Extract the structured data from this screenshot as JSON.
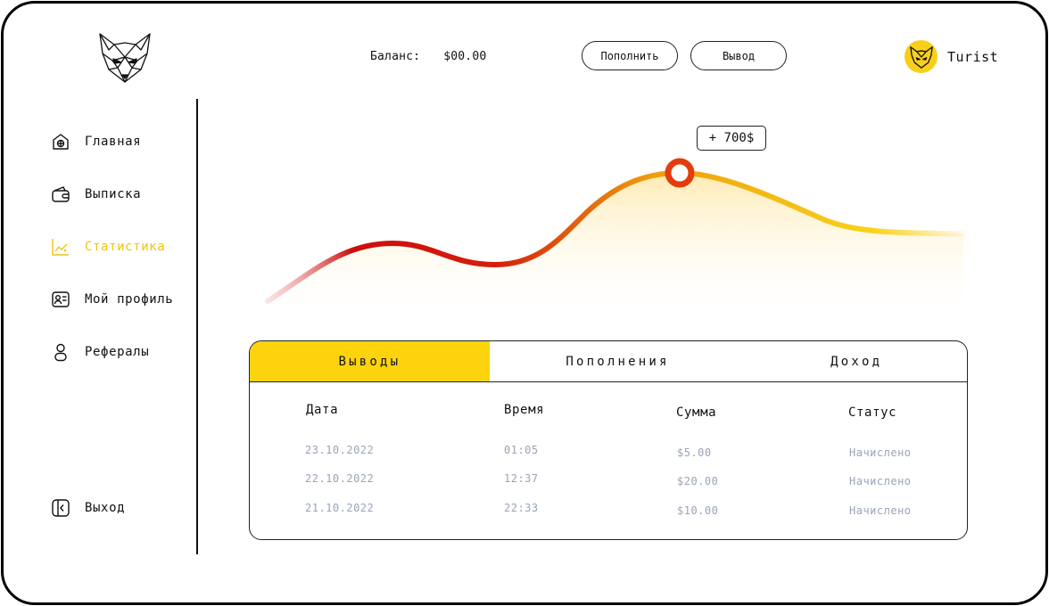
{
  "header": {
    "balance_label": "Баланс:",
    "balance_value": "$00.00",
    "deposit_label": "Пополнить",
    "withdraw_label": "Вывод",
    "username": "Turist"
  },
  "sidebar": {
    "items": [
      {
        "label": "Главная",
        "icon": "home-icon"
      },
      {
        "label": "Выписка",
        "icon": "wallet-icon"
      },
      {
        "label": "Статистика",
        "icon": "chart-icon",
        "active": true
      },
      {
        "label": "Мой профиль",
        "icon": "profile-card-icon"
      },
      {
        "label": "Рефералы",
        "icon": "user-icon"
      }
    ],
    "logout_label": "Выход"
  },
  "chart": {
    "tooltip": "+ 700$"
  },
  "table": {
    "tabs": [
      "Выводы",
      "Пополнения",
      "Доход"
    ],
    "active_tab": 0,
    "columns": [
      "Дата",
      "Время",
      "Сумма",
      "Статус"
    ],
    "rows": [
      [
        "23.10.2022",
        "01:05",
        "$5.00",
        "Начислено"
      ],
      [
        "22.10.2022",
        "12:37",
        "$20.00",
        "Начислено"
      ],
      [
        "21.10.2022",
        "22:33",
        "$10.00",
        "Начислено"
      ]
    ]
  },
  "colors": {
    "accent": "#fcd30d",
    "active_nav": "#f2c40f",
    "curve_start": "#cc0e0e",
    "curve_end": "#f7cf1b",
    "muted_text": "#9aa3b8"
  }
}
